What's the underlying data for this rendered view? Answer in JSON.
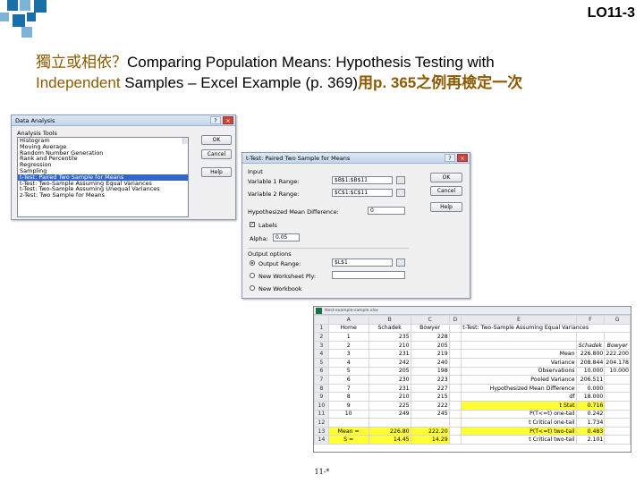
{
  "header": {
    "lo_label": "LO11-3",
    "title_cn": "獨立或相依？",
    "title_en1": "Comparing Population Means: Hypothesis Testing with",
    "title_en2_cn": "Independent",
    "title_en2": " Samples – Excel Example (p. 369)",
    "title_tail": "用p. 365之例再檢定一次"
  },
  "data_analysis": {
    "title": "Data Analysis",
    "help_symbol": "?",
    "close_symbol": "×",
    "tools_label": "Analysis Tools",
    "items": [
      "Histogram",
      "Moving Average",
      "Random Number Generation",
      "Rank and Percentile",
      "Regression",
      "Sampling",
      "t-Test: Paired Two Sample for Means",
      "t-Test: Two-Sample Assuming Equal Variances",
      "t-Test: Two-Sample Assuming Unequal Variances",
      "z-Test: Two Sample for Means"
    ],
    "selected_index": 6,
    "ok": "OK",
    "cancel": "Cancel",
    "help": "Help"
  },
  "ttest": {
    "title": "t-Test: Paired Two Sample for Means",
    "help_symbol": "?",
    "close_symbol": "×",
    "input_label": "Input",
    "var1_label": "Variable 1 Range:",
    "var1_value": "$B$1:$B$11",
    "var2_label": "Variable 2 Range:",
    "var2_value": "$C$1:$C$11",
    "hyp_label": "Hypothesized Mean Difference:",
    "hyp_value": "0",
    "labels_label": "Labels",
    "labels_checked": true,
    "alpha_label": "Alpha:",
    "alpha_value": "0.05",
    "output_label": "Output options",
    "output_range_label": "Output Range:",
    "output_range_value": "$L$1",
    "new_ws_label": "New Worksheet Ply:",
    "new_wb_label": "New Workbook",
    "ok": "OK",
    "cancel": "Cancel",
    "help": "Help"
  },
  "sheet": {
    "filename": "ttest-example-sample.xlsx",
    "col_headers": [
      "",
      "A",
      "B",
      "C",
      "D",
      "E",
      "F",
      "G"
    ],
    "rows": [
      [
        "1",
        "Home",
        "Schadek",
        "Bowyer",
        "",
        "t-Test: Two-Sample Assuming Equal Variances",
        "",
        ""
      ],
      [
        "2",
        "1",
        "235",
        "228",
        "",
        "",
        "",
        ""
      ],
      [
        "3",
        "2",
        "210",
        "205",
        "",
        "",
        "Schadek",
        "Bowyer"
      ],
      [
        "4",
        "3",
        "231",
        "219",
        "",
        "Mean",
        "226.800",
        "222.200"
      ],
      [
        "5",
        "4",
        "242",
        "240",
        "",
        "Variance",
        "208.844",
        "204.178"
      ],
      [
        "6",
        "5",
        "205",
        "198",
        "",
        "Observations",
        "10.000",
        "10.000"
      ],
      [
        "7",
        "6",
        "230",
        "223",
        "",
        "Pooled Variance",
        "206.511",
        ""
      ],
      [
        "8",
        "7",
        "231",
        "227",
        "",
        "Hypothesized Mean Difference",
        "0.000",
        ""
      ],
      [
        "9",
        "8",
        "210",
        "215",
        "",
        "df",
        "18.000",
        ""
      ],
      [
        "10",
        "9",
        "225",
        "222",
        "",
        "t Stat",
        "0.716",
        ""
      ],
      [
        "11",
        "10",
        "249",
        "245",
        "",
        "P(T<=t) one-tail",
        "0.242",
        ""
      ],
      [
        "12",
        "",
        "",
        "",
        "",
        "t Critical one-tail",
        "1.734",
        ""
      ],
      [
        "13",
        "Mean =",
        "226.80",
        "222.20",
        "",
        "P(T<=t) two-tail",
        "0.483",
        ""
      ],
      [
        "14",
        "S =",
        "14.45",
        "14.29",
        "",
        "t Critical two-tail",
        "2.101",
        ""
      ]
    ]
  },
  "footer": {
    "page": "11-*"
  }
}
